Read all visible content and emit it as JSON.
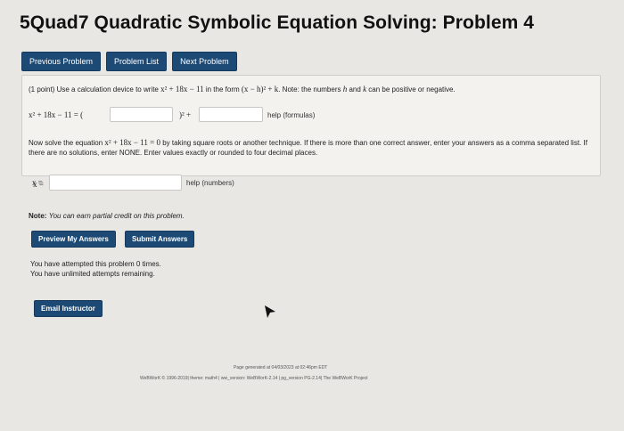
{
  "title": "5Quad7 Quadratic Symbolic Equation Solving: Problem 4",
  "nav": {
    "prev": "Previous Problem",
    "list": "Problem List",
    "next": "Next Problem"
  },
  "problem": {
    "points": "(1 point)",
    "instruction_a": "Use a calculation device to write",
    "expr1": "x² + 18x − 11",
    "instruction_b": "in the form",
    "form": "(x − h)² + k",
    "instruction_c": ". Note: the numbers",
    "h": "h",
    "and": "and",
    "k": "k",
    "instruction_d": "can be positive or negative.",
    "eq_left": "x² + 18x − 11 = (",
    "close_sq": ")² +",
    "help_formulas": "help (formulas)",
    "solve_a": "Now solve the equation",
    "eq2": "x² + 18x − 11 = 0",
    "solve_b": "by taking square roots or another technique. If there is more than one correct answer, enter your answers as",
    "solve_c": "a comma separated list. If there are no solutions, enter NONE. Enter values exactly or rounded to four decimal places.",
    "x_label": "x =",
    "help_numbers": "help (numbers)"
  },
  "note": {
    "label": "Note:",
    "text": "You can earn partial credit on this problem."
  },
  "actions": {
    "preview": "Preview My Answers",
    "submit": "Submit Answers"
  },
  "status": {
    "attempted": "You have attempted this problem 0 times.",
    "remaining": "You have unlimited attempts remaining."
  },
  "email": "Email Instructor",
  "footer": {
    "generated": "Page generated at 04/03/2023 at 02:46pm EDT",
    "version": "WeBWorK © 1996-2019| theme: math4 | ww_version: WeBWorK-2.14 | pg_version PG-2.14| The WeBWorK Project"
  },
  "colors": {
    "button": "#1d4a75",
    "page_bg": "#e9e7e4",
    "box_bg": "#f3f2ef"
  }
}
